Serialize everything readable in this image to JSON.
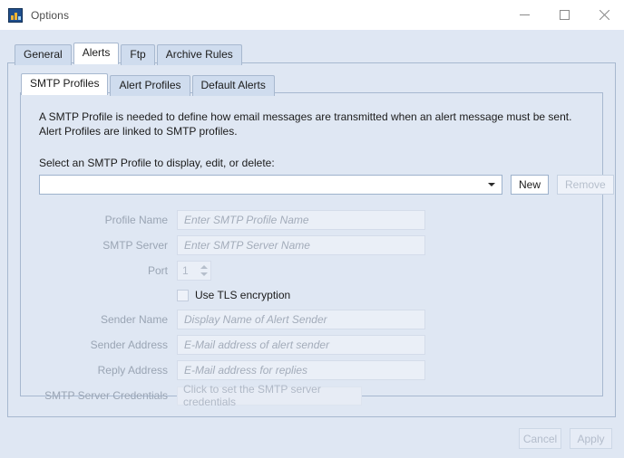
{
  "window": {
    "title": "Options",
    "icon": "chart-app-icon",
    "controls": {
      "minimize": "minimize-icon",
      "maximize": "maximize-icon",
      "close": "close-icon"
    }
  },
  "tabs": [
    {
      "label": "General",
      "active": false
    },
    {
      "label": "Alerts",
      "active": true
    },
    {
      "label": "Ftp",
      "active": false
    },
    {
      "label": "Archive Rules",
      "active": false
    }
  ],
  "inner_tabs": [
    {
      "label": "SMTP Profiles",
      "active": true
    },
    {
      "label": "Alert Profiles",
      "active": false
    },
    {
      "label": "Default Alerts",
      "active": false
    }
  ],
  "smtp": {
    "description": "A SMTP Profile is needed to define how email messages are transmitted when an alert message must be sent. Alert Profiles are linked to SMTP profiles.",
    "select_label": "Select an SMTP Profile to display, edit, or delete:",
    "profile_combo_value": "",
    "new_button": "New",
    "remove_button": "Remove",
    "fields": {
      "profile_name_label": "Profile Name",
      "profile_name_placeholder": "Enter SMTP Profile Name",
      "smtp_server_label": "SMTP Server",
      "smtp_server_placeholder": "Enter SMTP Server Name",
      "port_label": "Port",
      "port_value": "1",
      "tls_label": "Use TLS encryption",
      "sender_name_label": "Sender Name",
      "sender_name_placeholder": "Display Name of Alert Sender",
      "sender_address_label": "Sender Address",
      "sender_address_placeholder": "E-Mail address of alert sender",
      "reply_address_label": "Reply Address",
      "reply_address_placeholder": "E-Mail address for replies",
      "credentials_label": "SMTP Server Credentials",
      "credentials_button": "Click to set the SMTP server credentials"
    }
  },
  "footer": {
    "cancel": "Cancel",
    "apply": "Apply"
  },
  "colors": {
    "window_background": "#dfe7f3",
    "titlebar_background": "#ffffff",
    "tab_inactive": "#cfdcee",
    "tab_active": "#ffffff",
    "border": "#a7b8cf",
    "text": "#1b1b1b",
    "disabled_text": "#9aa5b4",
    "icon_blue": "#1f4e8c",
    "icon_yellow": "#f2b632"
  }
}
